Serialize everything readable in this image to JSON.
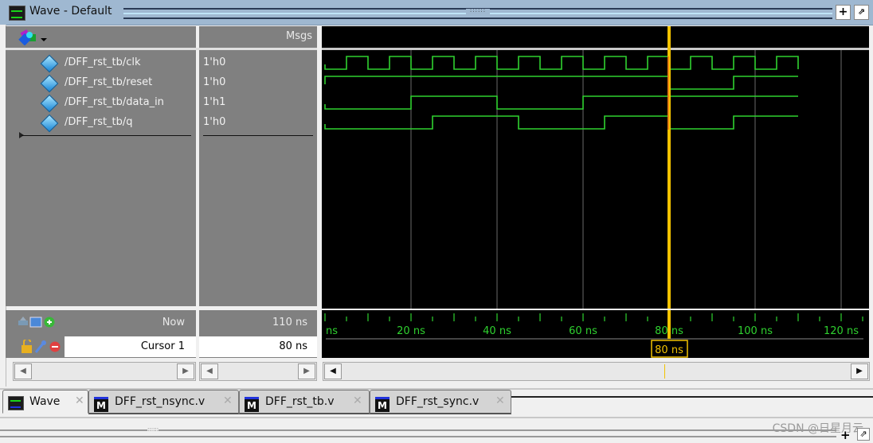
{
  "window": {
    "title": "Wave - Default",
    "buttons": {
      "dock": "+",
      "undock": "⇗"
    }
  },
  "header": {
    "toolbar_icon": "wave-tools-icon",
    "msgs_label": "Msgs"
  },
  "signals": [
    {
      "name": "/DFF_rst_tb/clk",
      "value": "1'h0"
    },
    {
      "name": "/DFF_rst_tb/reset",
      "value": "1'h0"
    },
    {
      "name": "/DFF_rst_tb/data_in",
      "value": "1'h1"
    },
    {
      "name": "/DFF_rst_tb/q",
      "value": "1'h0"
    }
  ],
  "status": {
    "now_label": "Now",
    "now_value": "110 ns",
    "cursor_label": "Cursor 1",
    "cursor_value": "80 ns",
    "cursor_time_tag": "80 ns"
  },
  "timeline": {
    "unit": "ns",
    "ticks": [
      {
        "t": 0,
        "label": "ns"
      },
      {
        "t": 20,
        "label": "20 ns"
      },
      {
        "t": 40,
        "label": "40 ns"
      },
      {
        "t": 60,
        "label": "60 ns"
      },
      {
        "t": 80,
        "label": "80 ns"
      },
      {
        "t": 100,
        "label": "100 ns"
      },
      {
        "t": 120,
        "label": "120 ns"
      }
    ],
    "view_start": 0,
    "view_end": 126,
    "sim_end": 110,
    "cursor_time": 80
  },
  "waveforms": {
    "clk": [
      [
        0,
        0
      ],
      [
        5,
        1
      ],
      [
        10,
        0
      ],
      [
        15,
        1
      ],
      [
        20,
        0
      ],
      [
        25,
        1
      ],
      [
        30,
        0
      ],
      [
        35,
        1
      ],
      [
        40,
        0
      ],
      [
        45,
        1
      ],
      [
        50,
        0
      ],
      [
        55,
        1
      ],
      [
        60,
        0
      ],
      [
        65,
        1
      ],
      [
        70,
        0
      ],
      [
        75,
        1
      ],
      [
        80,
        0
      ],
      [
        85,
        1
      ],
      [
        90,
        0
      ],
      [
        95,
        1
      ],
      [
        100,
        0
      ],
      [
        105,
        1
      ],
      [
        110,
        0
      ]
    ],
    "reset": [
      [
        0,
        1
      ],
      [
        80,
        0
      ],
      [
        95,
        1
      ]
    ],
    "data_in": [
      [
        0,
        0
      ],
      [
        20,
        1
      ],
      [
        40,
        0
      ],
      [
        60,
        1
      ]
    ],
    "q": [
      [
        0,
        0
      ],
      [
        25,
        1
      ],
      [
        45,
        0
      ],
      [
        65,
        1
      ],
      [
        80,
        0
      ],
      [
        95,
        1
      ]
    ]
  },
  "colors": {
    "wave": "#2fd12f",
    "cursor": "#f2c200",
    "cursor_edge": "#e04020",
    "grid": "#6a6a6a",
    "background": "#000000"
  },
  "tabs": [
    {
      "label": "Wave",
      "icon": "wave-icon",
      "active": true
    },
    {
      "label": "DFF_rst_nsync.v",
      "icon": "modelsim-file-icon",
      "active": false
    },
    {
      "label": "DFF_rst_tb.v",
      "icon": "modelsim-file-icon",
      "active": false
    },
    {
      "label": "DFF_rst_sync.v",
      "icon": "modelsim-file-icon",
      "active": false
    }
  ],
  "watermark": "CSDN @日星月云"
}
